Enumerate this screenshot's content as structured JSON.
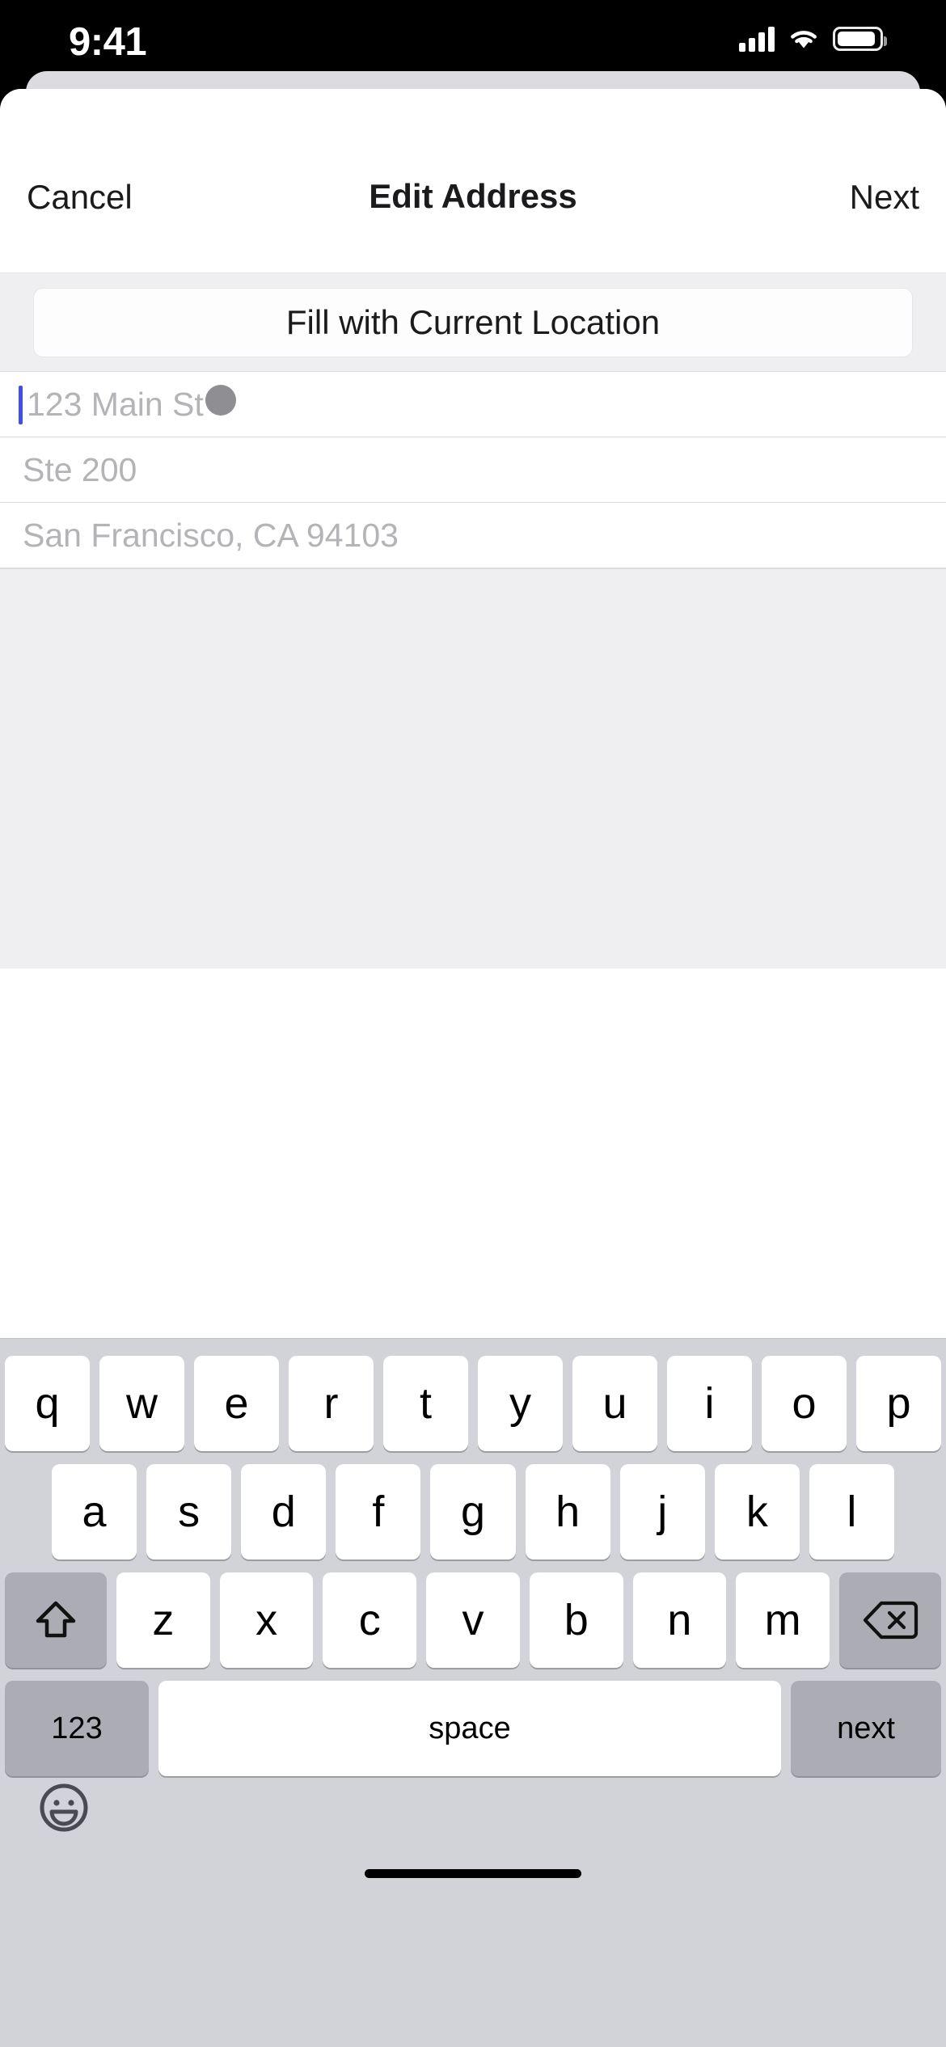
{
  "status_bar": {
    "time": "9:41",
    "cellular_icon": "signal-bars-icon",
    "wifi_icon": "wifi-icon",
    "battery_icon": "battery-icon"
  },
  "nav_bar": {
    "cancel_label": "Cancel",
    "title": "Edit Address",
    "next_label": "Next"
  },
  "fill_button": {
    "label": "Fill with Current Location"
  },
  "form": {
    "fields": [
      {
        "name": "street-address",
        "placeholder": "123 Main St",
        "value": "",
        "focused": true
      },
      {
        "name": "street-address-2",
        "placeholder": "Ste 200",
        "value": "",
        "focused": false
      },
      {
        "name": "city-state-zip",
        "placeholder": "San Francisco, CA 94103",
        "value": "",
        "focused": false
      }
    ]
  },
  "keyboard": {
    "row1": [
      "q",
      "w",
      "e",
      "r",
      "t",
      "y",
      "u",
      "i",
      "o",
      "p"
    ],
    "row2": [
      "a",
      "s",
      "d",
      "f",
      "g",
      "h",
      "j",
      "k",
      "l"
    ],
    "row3": [
      "z",
      "x",
      "c",
      "v",
      "b",
      "n",
      "m"
    ],
    "shift_icon": "shift-arrow-icon",
    "backspace_icon": "backspace-delete-icon",
    "numbers_label": "123",
    "space_label": "space",
    "return_label": "next",
    "emoji_icon": "smiley-face-icon"
  },
  "colors": {
    "caret": "#3F51E0",
    "tap_indicator": "#8E8E93",
    "keyboard_bg": "#D2D3D8",
    "key_white": "#FFFFFF",
    "key_gray": "#ACADB4",
    "section_bg": "#EFEEF1"
  }
}
